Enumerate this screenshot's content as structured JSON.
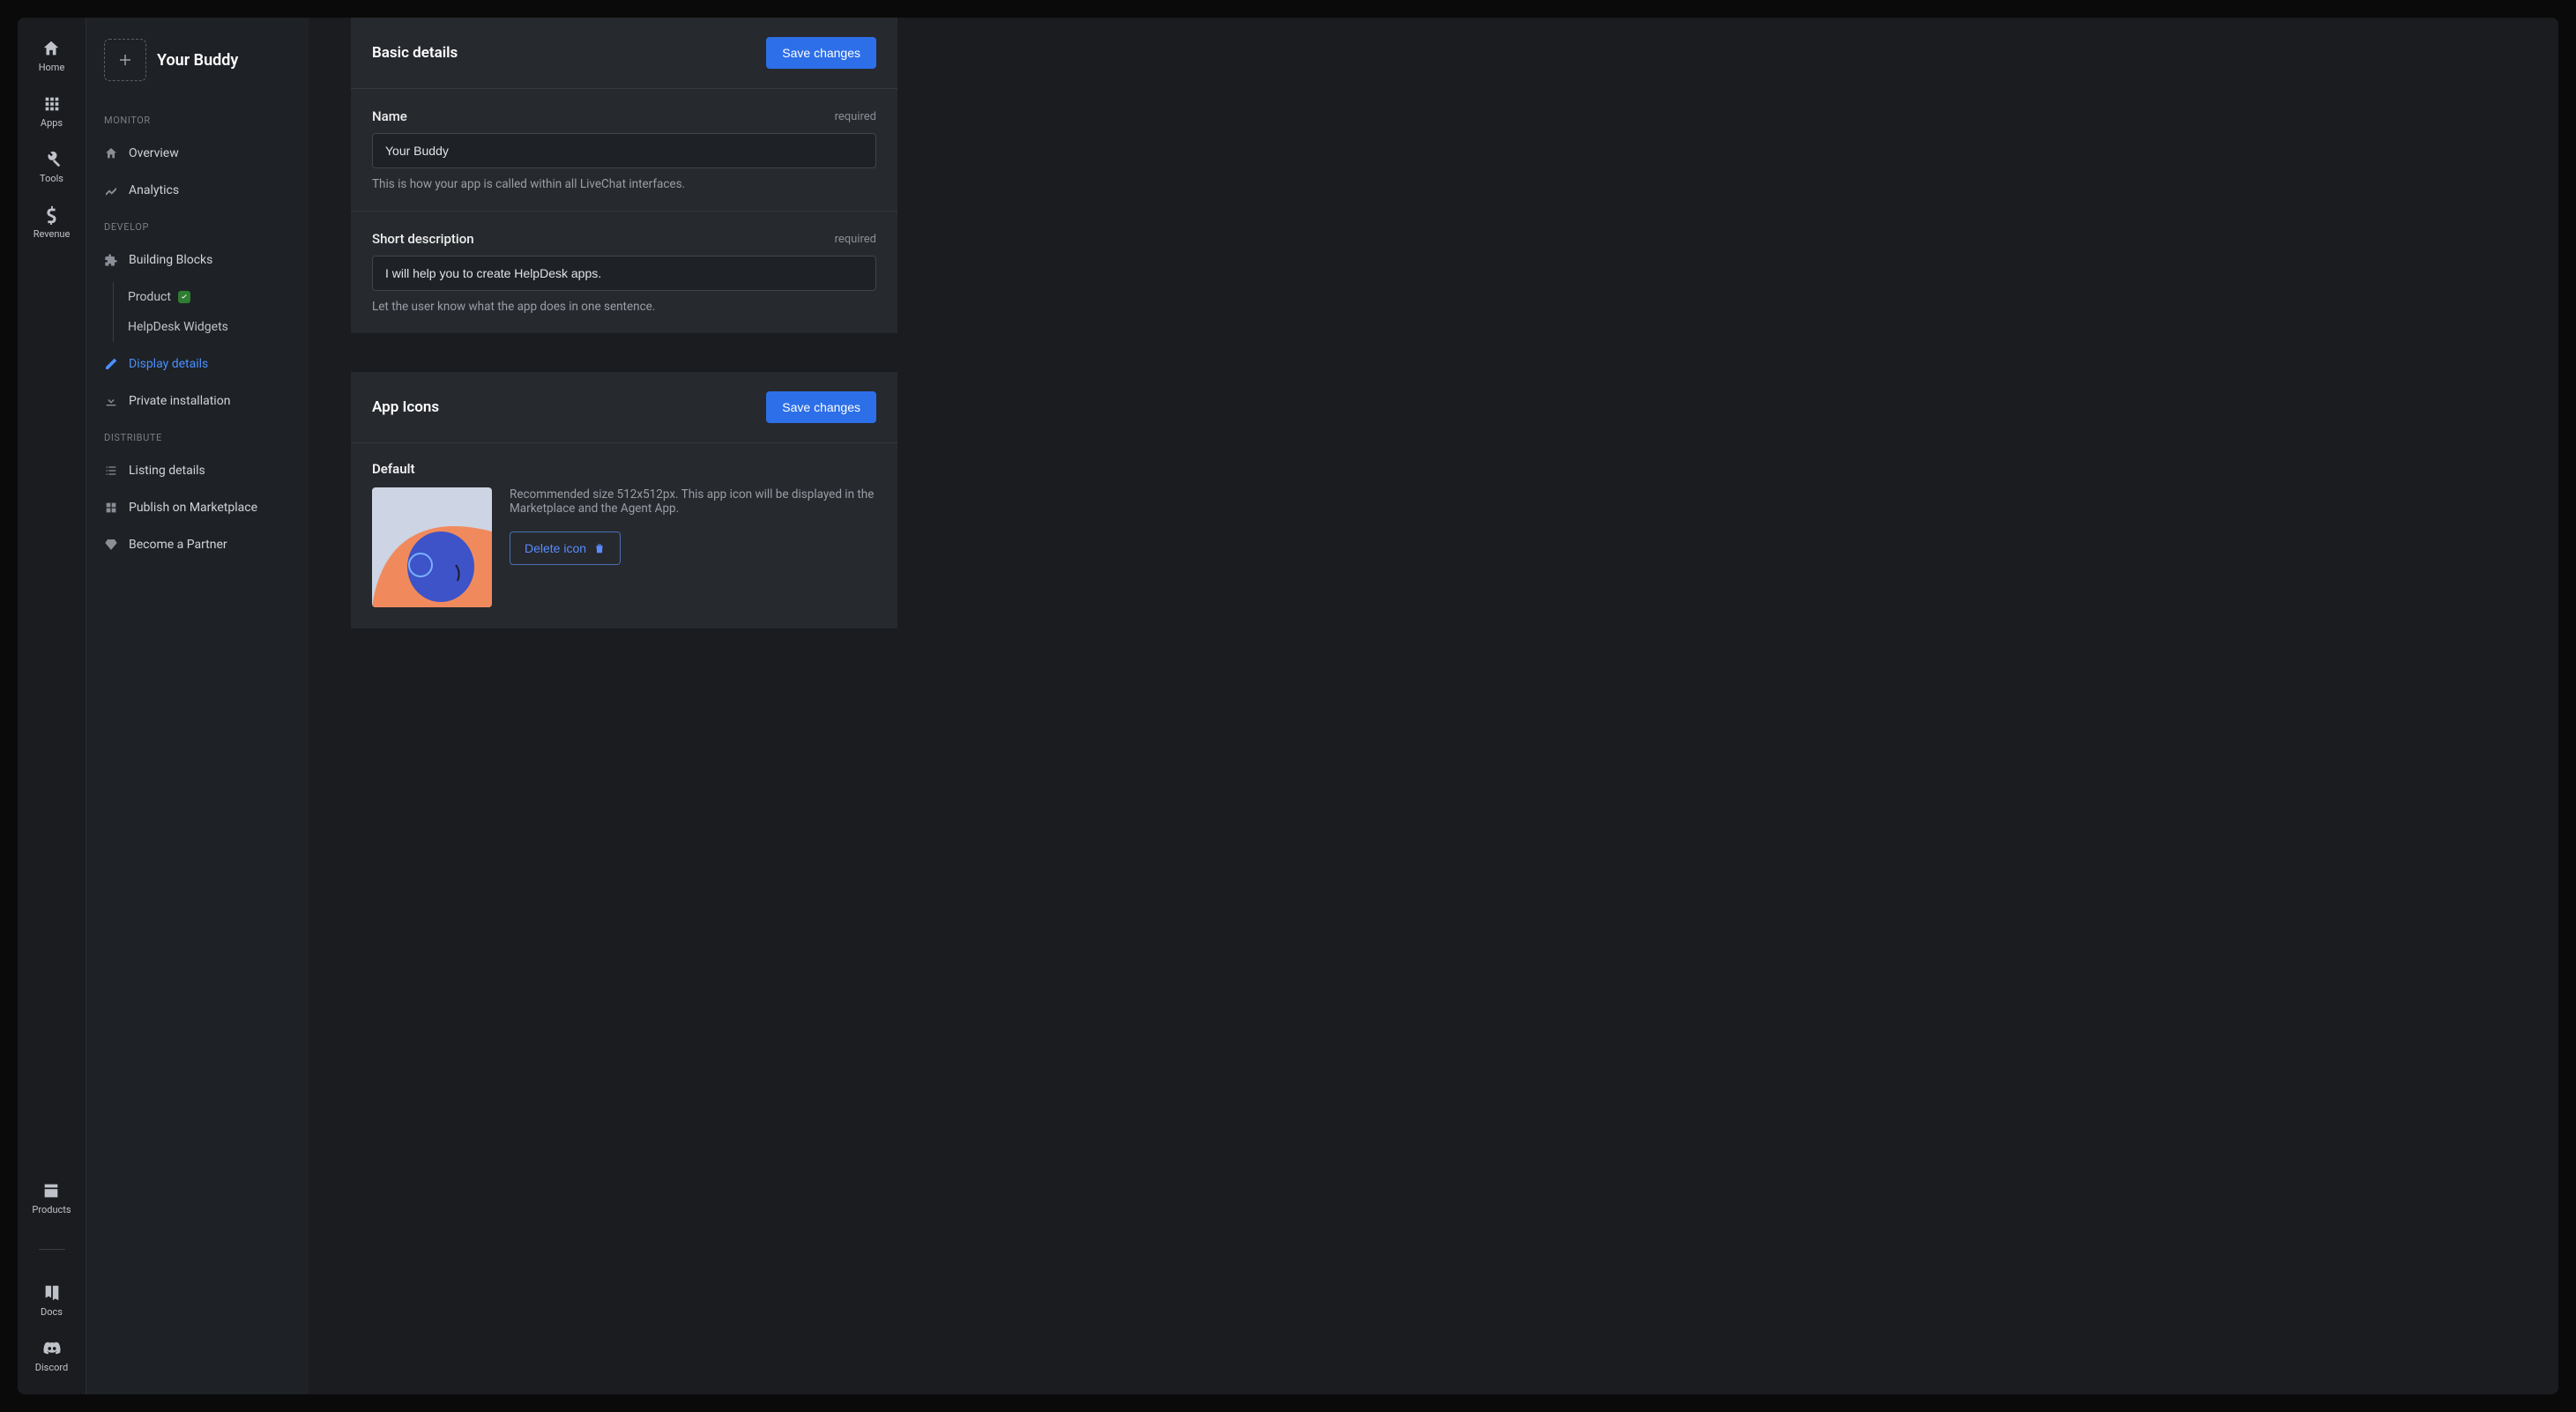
{
  "rail": {
    "top": [
      {
        "key": "home",
        "label": "Home"
      },
      {
        "key": "apps",
        "label": "Apps"
      },
      {
        "key": "tools",
        "label": "Tools"
      },
      {
        "key": "revenue",
        "label": "Revenue"
      }
    ],
    "bottom": [
      {
        "key": "products",
        "label": "Products"
      },
      {
        "key": "docs",
        "label": "Docs"
      },
      {
        "key": "discord",
        "label": "Discord"
      }
    ]
  },
  "sidebar": {
    "app_name": "Your Buddy",
    "sections": {
      "monitor": {
        "label": "MONITOR",
        "items": [
          {
            "key": "overview",
            "label": "Overview"
          },
          {
            "key": "analytics",
            "label": "Analytics"
          }
        ]
      },
      "develop": {
        "label": "DEVELOP",
        "items": [
          {
            "key": "building-blocks",
            "label": "Building Blocks",
            "sub": [
              {
                "key": "product",
                "label": "Product",
                "checked": true
              },
              {
                "key": "helpdesk-widgets",
                "label": "HelpDesk Widgets"
              }
            ]
          },
          {
            "key": "display-details",
            "label": "Display details",
            "active": true
          },
          {
            "key": "private-installation",
            "label": "Private installation"
          }
        ]
      },
      "distribute": {
        "label": "DISTRIBUTE",
        "items": [
          {
            "key": "listing-details",
            "label": "Listing details"
          },
          {
            "key": "publish",
            "label": "Publish on Marketplace"
          },
          {
            "key": "partner",
            "label": "Become a Partner"
          }
        ]
      }
    }
  },
  "main": {
    "basic": {
      "title": "Basic details",
      "save": "Save changes",
      "name_label": "Name",
      "name_required": "required",
      "name_value": "Your Buddy",
      "name_help": "This is how your app is called within all LiveChat interfaces.",
      "desc_label": "Short description",
      "desc_required": "required",
      "desc_value": "I will help you to create HelpDesk apps.",
      "desc_help": "Let the user know what the app does in one sentence."
    },
    "icons": {
      "title": "App Icons",
      "save": "Save changes",
      "default_label": "Default",
      "default_help": "Recommended size 512x512px. This app icon will be displayed in the Marketplace and the Agent App.",
      "delete": "Delete icon"
    }
  }
}
